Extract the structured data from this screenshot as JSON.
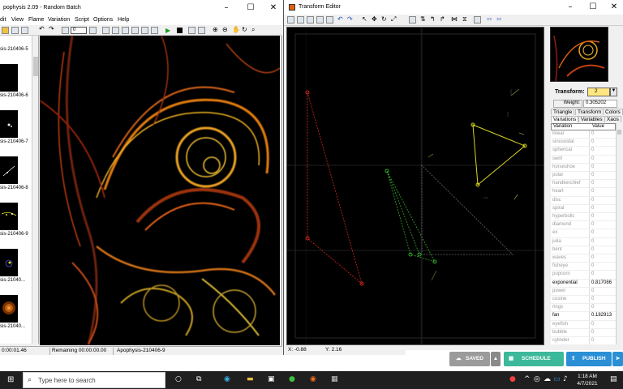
{
  "apophysis": {
    "title": "pophysis 2.09 - Random Batch",
    "menu": [
      "dit",
      "View",
      "Flame",
      "Variation",
      "Script",
      "Options",
      "Help"
    ],
    "toolbar_combo": "0",
    "thumbnails": [
      "sis-210406-5",
      "sis-210406-6",
      "sis-210406-7",
      "sis-210406-8",
      "sis-210406-9",
      "sis-21040...",
      "sis-21040..."
    ],
    "status": {
      "elapsed": "0:00:01.46",
      "remaining": "Remaining 00:00:00.00",
      "flame": "Apophysis-210406-9"
    }
  },
  "transform_editor": {
    "title": "Transform Editor",
    "coords": {
      "x": "X: -0.88",
      "y": "Y: 2.16"
    },
    "transform_label": "Transform:",
    "transform_value": "2",
    "weight_label": "Weight:",
    "weight_value": "0.305202",
    "tabs_row1": [
      "Triangle",
      "Transform",
      "Colors"
    ],
    "tabs_row2": [
      "Variations",
      "Variables",
      "Xaos"
    ],
    "var_header": {
      "name": "Variation",
      "value": "Value"
    },
    "variations": [
      {
        "name": "linear",
        "value": "0",
        "active": false
      },
      {
        "name": "sinusoidal",
        "value": "0",
        "active": false
      },
      {
        "name": "spherical",
        "value": "0",
        "active": false
      },
      {
        "name": "swirl",
        "value": "0",
        "active": false
      },
      {
        "name": "horseshoe",
        "value": "0",
        "active": false
      },
      {
        "name": "polar",
        "value": "0",
        "active": false
      },
      {
        "name": "handkerchief",
        "value": "0",
        "active": false
      },
      {
        "name": "heart",
        "value": "0",
        "active": false
      },
      {
        "name": "disc",
        "value": "0",
        "active": false
      },
      {
        "name": "spiral",
        "value": "0",
        "active": false
      },
      {
        "name": "hyperbolic",
        "value": "0",
        "active": false
      },
      {
        "name": "diamond",
        "value": "0",
        "active": false
      },
      {
        "name": "ex",
        "value": "0",
        "active": false
      },
      {
        "name": "julia",
        "value": "0",
        "active": false
      },
      {
        "name": "bent",
        "value": "0",
        "active": false
      },
      {
        "name": "waves",
        "value": "0",
        "active": false
      },
      {
        "name": "fisheye",
        "value": "0",
        "active": false
      },
      {
        "name": "popcorn",
        "value": "0",
        "active": false
      },
      {
        "name": "exponential",
        "value": "0.817086",
        "active": true
      },
      {
        "name": "power",
        "value": "0",
        "active": false
      },
      {
        "name": "cosine",
        "value": "0",
        "active": false
      },
      {
        "name": "rings",
        "value": "0",
        "active": false
      },
      {
        "name": "fan",
        "value": "0.182913",
        "active": true
      },
      {
        "name": "eyefish",
        "value": "0",
        "active": false
      },
      {
        "name": "bubble",
        "value": "0",
        "active": false
      },
      {
        "name": "cylinder",
        "value": "0",
        "active": false
      }
    ]
  },
  "actions": {
    "saved": "SAVED",
    "schedule": "SCHEDULE",
    "publish": "PUBLISH"
  },
  "taskbar": {
    "search_placeholder": "Type here to search",
    "time": "1:18 AM",
    "date": "4/7/2021"
  },
  "colors": {
    "triangle_red": "#d42a1a",
    "triangle_green": "#34a82a",
    "triangle_yellow": "#d8d420",
    "saved_btn": "#9b9b9b",
    "schedule_btn": "#3cb89a",
    "publish_btn": "#2a8fd4"
  }
}
